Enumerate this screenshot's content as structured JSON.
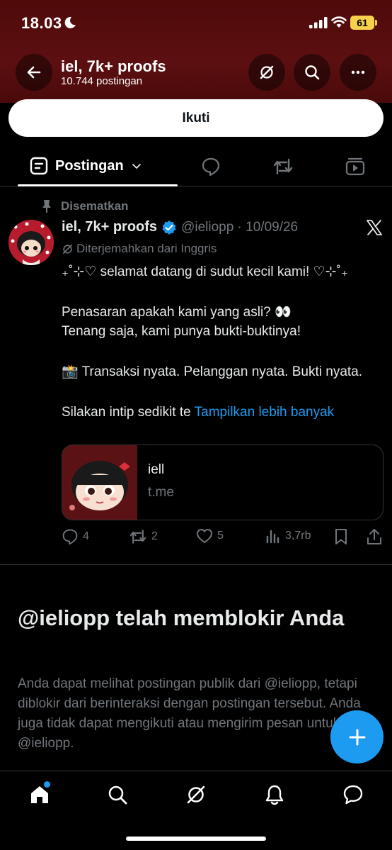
{
  "status_bar": {
    "time": "18.03",
    "battery": "61"
  },
  "header": {
    "title": "iel, 7k+ proofs",
    "subtitle": "10.744 postingan",
    "icons": [
      "back-arrow-icon",
      "grok-icon",
      "search-icon",
      "more-icon"
    ]
  },
  "follow_button": {
    "label": "Ikuti"
  },
  "tabs": {
    "active_label": "Postingan"
  },
  "post": {
    "pinned_label": "Disematkan",
    "author_name": "iel, 7k+ proofs",
    "handle_date": "@ieliopp · 10/09/26",
    "translated_label": "Diterjemahkan dari Inggris",
    "lines": {
      "l1": "₊˚⊹♡ selamat datang di sudut kecil kami! ♡⊹˚₊",
      "l2": "Penasaran apakah kami yang asli? 👀",
      "l3": "Tenang saja, kami punya bukti-buktinya!",
      "l4": "📸 Transaksi nyata. Pelanggan nyata. Bukti nyata.",
      "l5": "Silakan intip sedikit te",
      "show_more": "Tampilkan lebih banyak"
    },
    "card": {
      "title": "iell",
      "domain": "t.me"
    },
    "stats": {
      "replies": "4",
      "reposts": "2",
      "likes": "5",
      "views": "3,7rb"
    }
  },
  "blocked": {
    "title": "@ieliopp telah memblokir Anda",
    "body": "Anda dapat melihat postingan publik dari @ieliopp, tetapi diblokir dari berinteraksi dengan postingan tersebut. Anda juga tidak dapat mengikuti atau mengirim pesan untuk @ieliopp."
  },
  "colors": {
    "accent": "#1d9bf0",
    "header_bg": "#5c0f10",
    "muted": "#71767b"
  }
}
